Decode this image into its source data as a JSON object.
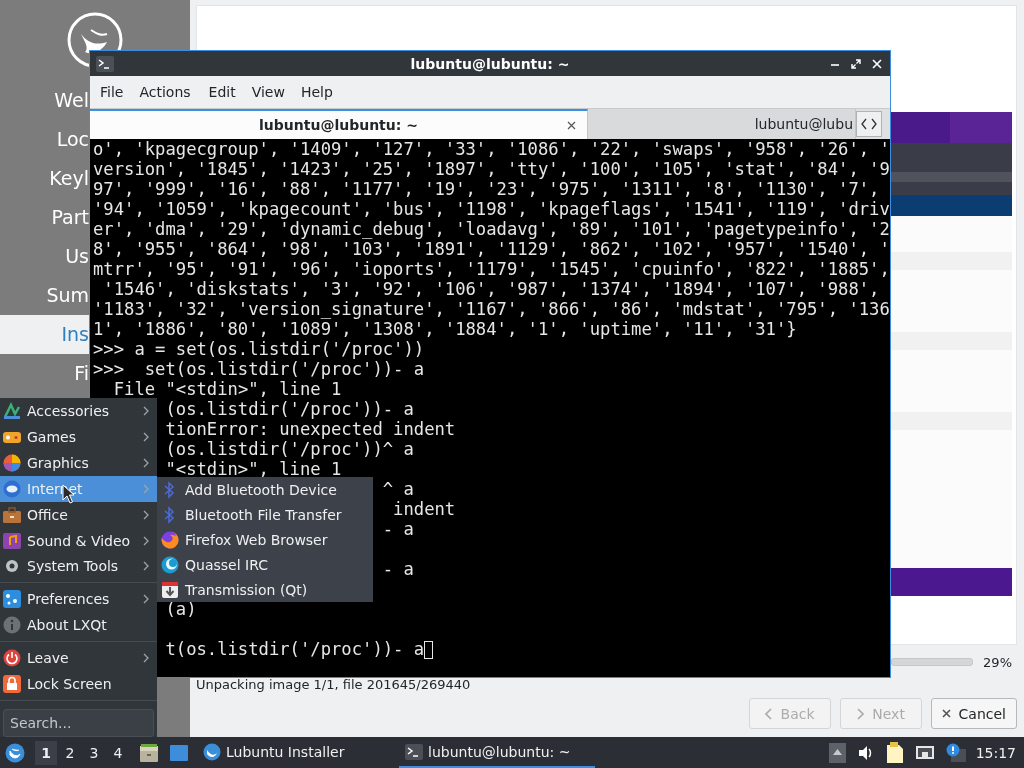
{
  "installer": {
    "sidebar": {
      "items": [
        {
          "label": "Wel",
          "selected": false
        },
        {
          "label": "Loc",
          "selected": false
        },
        {
          "label": "Keyl",
          "selected": false
        },
        {
          "label": "Part",
          "selected": false
        },
        {
          "label": "Us",
          "selected": false
        },
        {
          "label": "Sum",
          "selected": false
        },
        {
          "label": "Ins",
          "selected": true
        },
        {
          "label": "Fi",
          "selected": false
        }
      ]
    },
    "progress": {
      "reading": "29%"
    },
    "status": "Unpacking image 1/1, file 201645/269440",
    "buttons": [
      {
        "label": "Back",
        "kind": "back",
        "disabled": true
      },
      {
        "label": "Next",
        "kind": "next",
        "disabled": true
      },
      {
        "label": "Cancel",
        "kind": "cancel",
        "disabled": false
      }
    ]
  },
  "terminal": {
    "title": "lubuntu@lubuntu: ~",
    "menu": [
      "File",
      "Actions",
      "Edit",
      "View",
      "Help"
    ],
    "tabs": [
      {
        "label": "lubuntu@lubuntu: ~",
        "selected": true
      },
      {
        "label": "lubuntu@lubu",
        "selected": false
      }
    ],
    "cursor": true,
    "lines": [
      {
        "kind": "text",
        "text": "o', 'kpagecgroup', '1409', '127', '33', '1086', '22', 'swaps', '958', '26', '"
      },
      {
        "kind": "text",
        "text": "version', '1845', '1423', '25', '1897', 'tty', '100', '105', 'stat', '84', '9"
      },
      {
        "kind": "text",
        "text": "97', '999', '16', '88', '1177', '19', '23', '975', '1311', '8', '1130', '7',"
      },
      {
        "kind": "text",
        "text": "'94', '1059', 'kpagecount', 'bus', '1198', 'kpageflags', '1541', '119', 'driv"
      },
      {
        "kind": "text",
        "text": "er', 'dma', '29', 'dynamic_debug', 'loadavg', '89', '101', 'pagetypeinfo', '2"
      },
      {
        "kind": "text",
        "text": "8', '955', '864', '98', '103', '1891', '1129', '862', '102', '957', '1540', '"
      },
      {
        "kind": "text",
        "text": "mtrr', '95', '91', '96', 'ioports', '1179', '1545', 'cpuinfo', '822', '1885',"
      },
      {
        "kind": "text",
        "text": " '1546', 'diskstats', '3', '92', '106', '987', '1374', '1894', '107', '988',"
      },
      {
        "kind": "text",
        "text": "'1183', '32', 'version_signature', '1167', '866', '86', 'mdstat', '795', '136"
      },
      {
        "kind": "text",
        "text": "1', '1886', '80', '1089', '1308', '1884', '1', 'uptime', '11', '31'}"
      },
      {
        "kind": "text",
        "text": ">>> a = set(os.listdir('/proc'))"
      },
      {
        "kind": "text",
        "text": ">>>  set(os.listdir('/proc'))- a"
      },
      {
        "kind": "text",
        "text": "  File \"<stdin>\", line 1"
      },
      {
        "kind": "text",
        "text": "       (os.listdir('/proc'))- a"
      },
      {
        "kind": "text",
        "text": "       tionError: unexpected indent"
      },
      {
        "kind": "text",
        "text": "       (os.listdir('/proc'))^ a"
      },
      {
        "kind": "text",
        "text": "       \"<stdin>\", line 1"
      },
      {
        "kind": "text",
        "text": "                            ^ a"
      },
      {
        "kind": "text",
        "text": "                             indent"
      },
      {
        "kind": "text",
        "text": "                            - a"
      },
      {
        "kind": "blank"
      },
      {
        "kind": "text",
        "text": "                            - a"
      },
      {
        "kind": "blank"
      },
      {
        "kind": "text",
        "text": "       (a)"
      },
      {
        "kind": "blank"
      },
      {
        "kind": "text",
        "text": "       t(os.listdir('/proc'))- a"
      }
    ]
  },
  "app_menu": {
    "sections": [
      [
        {
          "label": "Accessories",
          "submenu": true,
          "selected": false
        },
        {
          "label": "Games",
          "submenu": true,
          "selected": false
        },
        {
          "label": "Graphics",
          "submenu": true,
          "selected": false
        },
        {
          "label": "Internet",
          "submenu": true,
          "selected": true
        },
        {
          "label": "Office",
          "submenu": true,
          "selected": false
        },
        {
          "label": "Sound & Video",
          "submenu": true,
          "selected": false
        },
        {
          "label": "System Tools",
          "submenu": true,
          "selected": false
        }
      ],
      [
        {
          "label": "Preferences",
          "submenu": true,
          "selected": false
        },
        {
          "label": "About LXQt",
          "submenu": false,
          "selected": false
        }
      ],
      [
        {
          "label": "Leave",
          "submenu": true,
          "selected": false
        },
        {
          "label": "Lock Screen",
          "submenu": false,
          "selected": false
        }
      ]
    ],
    "search": {
      "placeholder": "Search..."
    }
  },
  "submenu": {
    "items": [
      {
        "label": "Add Bluetooth Device"
      },
      {
        "label": "Bluetooth File Transfer"
      },
      {
        "label": "Firefox Web Browser"
      },
      {
        "label": "Quassel IRC"
      },
      {
        "label": "Transmission (Qt)"
      }
    ]
  },
  "taskbar": {
    "desktops": [
      {
        "label": "1",
        "selected": true
      },
      {
        "label": "2",
        "selected": false
      },
      {
        "label": "3",
        "selected": false
      },
      {
        "label": "4",
        "selected": false
      }
    ],
    "tasks": [
      {
        "label": "Lubuntu Installer",
        "selected": false
      },
      {
        "label": "lubuntu@lubuntu: ~",
        "selected": true
      }
    ],
    "clock": "15:17"
  }
}
